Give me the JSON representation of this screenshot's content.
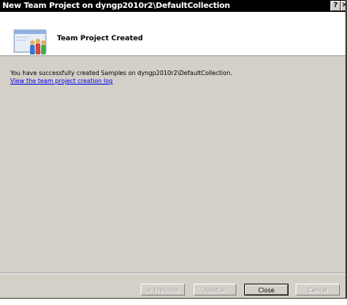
{
  "window": {
    "title": "New Team Project on dyngp2010r2\\DefaultCollection",
    "help_glyph": "?",
    "close_glyph": "✕"
  },
  "header": {
    "heading": "Team Project Created"
  },
  "content": {
    "message": "You have successfully created Samples on dyngp2010r2\\DefaultCollection.",
    "log_link": "View the team project creation log"
  },
  "buttons": {
    "previous": "< Previous",
    "next": "Next >",
    "close": "Close",
    "cancel": "Cancel"
  }
}
